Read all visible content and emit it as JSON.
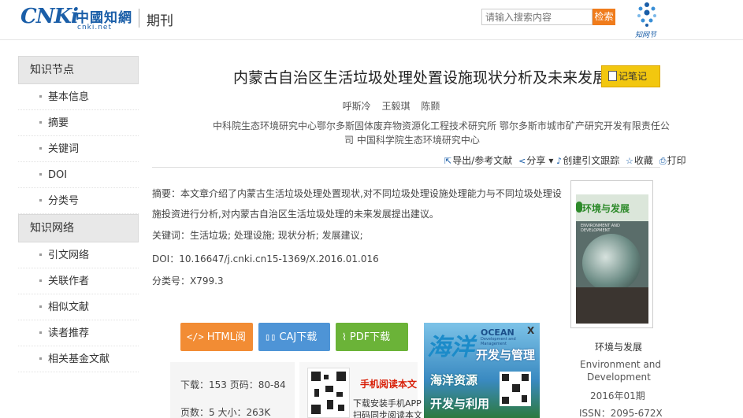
{
  "header": {
    "logo_main": "CNKi",
    "logo_cn": "中國知網",
    "logo_net": "cnki.net",
    "section": "期刊",
    "search_placeholder": "请输入搜索内容",
    "search_button": "检索",
    "brand_text": "知网节"
  },
  "sidebar": {
    "group1": "知识节点",
    "group1_items": [
      "基本信息",
      "摘要",
      "关键词",
      "DOI",
      "分类号"
    ],
    "group2": "知识网络",
    "group2_items": [
      "引文网络",
      "关联作者",
      "相似文献",
      "读者推荐",
      "相关基金文献"
    ]
  },
  "article": {
    "title": "内蒙古自治区生活垃圾处理处置设施现状分析及未来发展建议",
    "note_button": "记笔记",
    "authors": [
      "呼斯冷",
      "王毅琪",
      "陈颢"
    ],
    "affiliation_line1": "中科院生态环境研究中心鄂尔多斯固体废弃物资源化工程技术研究所   鄂尔多斯市城市矿产研究开发有限责任公",
    "affiliation_line2": "司   中国科学院生态环境研究中心",
    "abstract_label": "摘要：",
    "abstract_text": "本文章介绍了内蒙古生活垃圾处理处置现状,对不同垃圾处理设施处理能力与不同垃圾处理设施投资进行分析,对内蒙古自治区生活垃圾处理的未来发展提出建议。",
    "keywords_label": "关键词：",
    "keywords": "生活垃圾; 处理设施; 现状分析; 发展建议;",
    "doi_label": "DOI：",
    "doi": "10.16647/j.cnki.cn15-1369/X.2016.01.016",
    "class_label": "分类号：",
    "class_no": "X799.3"
  },
  "toolbar": {
    "export": "导出/参考文献",
    "share": "分享",
    "citation": "创建引文跟踪",
    "favorite": "收藏",
    "print": "打印"
  },
  "downloads": {
    "html": "HTML阅读",
    "caj": "CAJ下载",
    "pdf": "PDF下载"
  },
  "stats": {
    "line1": "下载：153   页码：80-84",
    "line2": "页数：5   大小：263K"
  },
  "mobile": {
    "title": "手机阅读本文",
    "desc1": "下载安装手机APP",
    "desc2": "扫码同步阅读本文"
  },
  "ad": {
    "big": "海洋",
    "ocean": "OCEAN",
    "ocean_sub": "Development and Management",
    "title": "开发与管理",
    "line1": "海洋资源",
    "line2": "开发与利用",
    "close": "X"
  },
  "journal": {
    "cover_title": "环境与发展",
    "cover_sub": "ENVIRONMENT AND DEVELOPMENT",
    "name": "环境与发展",
    "en1": "Environment and",
    "en2": "Development",
    "date": "2016年01期",
    "issn": "ISSN：2095-672X"
  }
}
